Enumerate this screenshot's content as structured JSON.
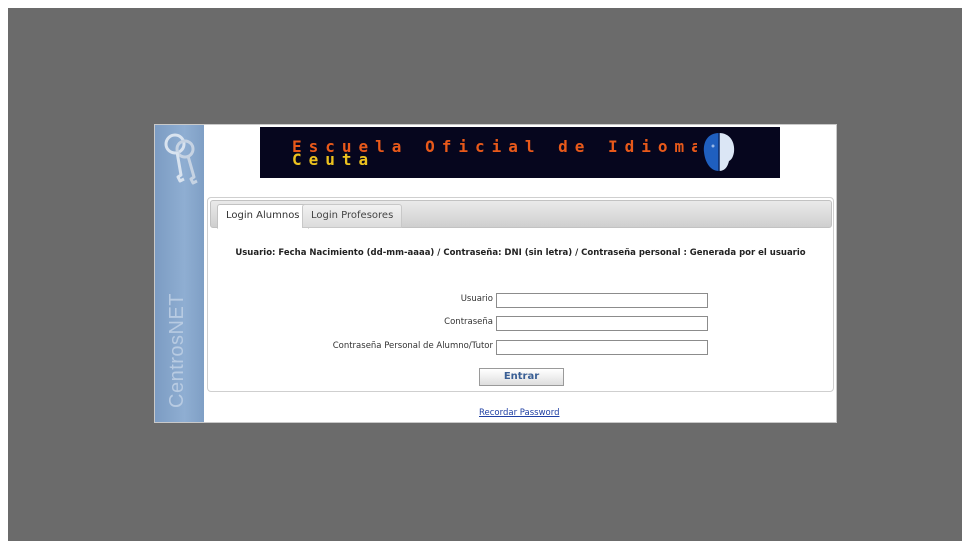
{
  "sidebar": {
    "brand": "CentrosNET",
    "icon": "keys-icon"
  },
  "banner": {
    "title": "Escuela Oficial de Idiomas",
    "subtitle": "Ceuta",
    "logo_icon": "school-logo-icon",
    "colors": {
      "background": "#06061e",
      "title": "#e8591a",
      "subtitle": "#ecc21f"
    }
  },
  "tabs": [
    {
      "label": "Login Alumnos",
      "active": true
    },
    {
      "label": "Login Profesores",
      "active": false
    }
  ],
  "login": {
    "instructions": "Usuario: Fecha Nacimiento (dd-mm-aaaa) / Contraseña: DNI (sin letra) / Contraseña personal : Generada por el usuario",
    "fields": {
      "usuario": {
        "label": "Usuario",
        "value": ""
      },
      "contrasena": {
        "label": "Contraseña",
        "value": ""
      },
      "contrasena_personal": {
        "label": "Contraseña Personal de Alumno/Tutor",
        "value": ""
      }
    },
    "submit_label": "Entrar",
    "forgot_label": "Recordar Password"
  },
  "colors": {
    "backdrop": "#6b6b6b",
    "sidebar": "#8faed2",
    "link": "#1f3fa3",
    "button_text": "#3a5f95"
  }
}
